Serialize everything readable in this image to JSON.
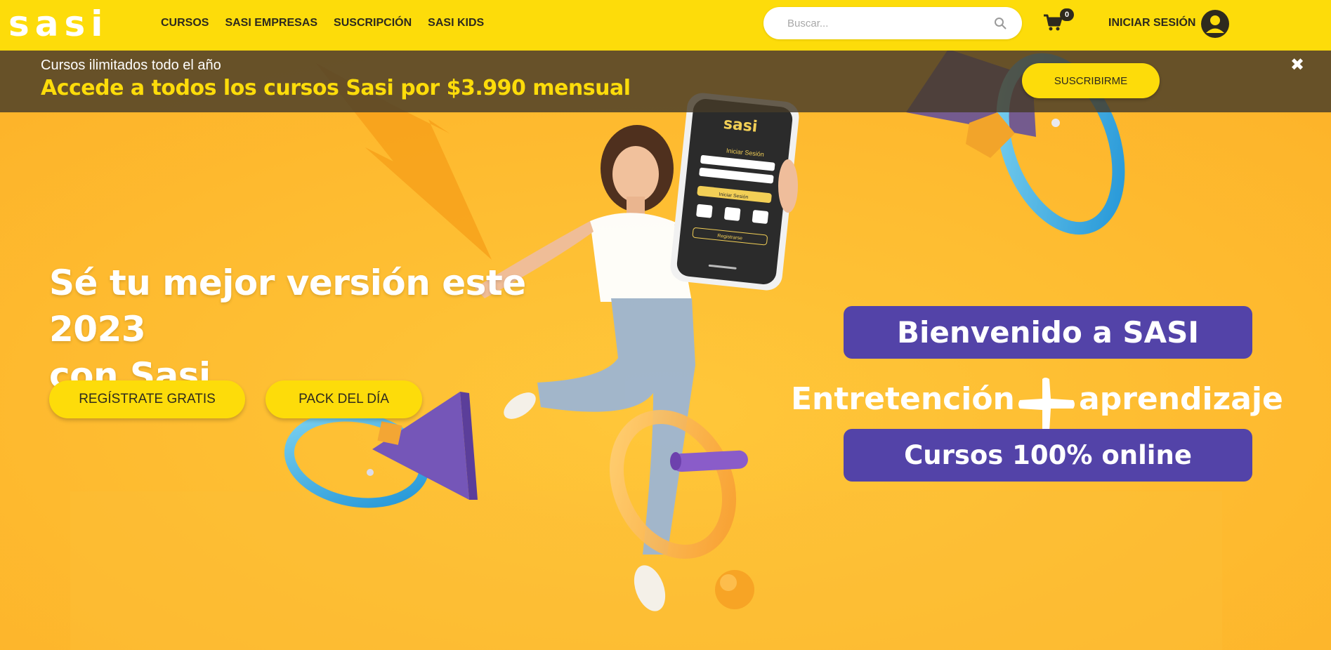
{
  "header": {
    "logo": "sasi",
    "nav": [
      "CURSOS",
      "SASI EMPRESAS",
      "SUSCRIPCIÓN",
      "SASI KIDS"
    ],
    "search_placeholder": "Buscar...",
    "cart_count": "0",
    "login_label": "INICIAR SESIÓN"
  },
  "promo": {
    "subtitle": "Cursos ilimitados todo el año",
    "title": "Accede a todos los cursos Sasi por $3.990 mensual",
    "button": "SUSCRIBIRME",
    "close": "✖"
  },
  "hero": {
    "title_line1": "Sé tu mejor versión este 2023",
    "title_line2": "con Sasi",
    "register_button": "REGÍSTRATE GRATIS",
    "pack_button": "PACK DEL DÍA",
    "welcome": "Bienvenido a SASI",
    "tagline_left": "Entretención",
    "tagline_right": "aprendizaje",
    "online": "Cursos 100% online"
  },
  "phone": {
    "logo": "sasi",
    "heading": "Iniciar Sesión",
    "login_button": "Iniciar Sesión",
    "register": "Registrarse"
  },
  "icons": {
    "search": "search-icon",
    "cart": "cart-icon",
    "avatar": "user-avatar-icon",
    "close": "close-icon"
  },
  "colors": {
    "header_yellow": "#fddc0a",
    "hero_orange": "#fdb82a",
    "purple": "#5343a8",
    "banner_dark": "#463a28"
  }
}
